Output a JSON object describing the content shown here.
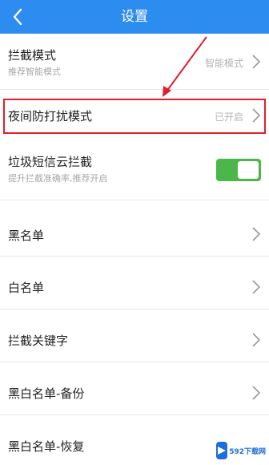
{
  "header": {
    "title": "设置"
  },
  "rows": [
    {
      "label": "拦截模式",
      "sub": "推荐智能模式",
      "value": "智能模式"
    },
    {
      "label": "夜间防打扰模式",
      "value": "已开启"
    },
    {
      "label": "垃圾短信云拦截",
      "sub": "提升拦截准确率,推荐开启",
      "toggle_on": true
    },
    {
      "label": "黑名单"
    },
    {
      "label": "白名单"
    },
    {
      "label": "拦截关键字"
    },
    {
      "label": "黑白名单-备份"
    },
    {
      "label": "黑白名单-恢复"
    }
  ],
  "watermark": {
    "text": "592下载网"
  },
  "colors": {
    "header": "#2d8cf0",
    "highlight": "#e01f2d",
    "toggle_on": "#4cb749"
  }
}
